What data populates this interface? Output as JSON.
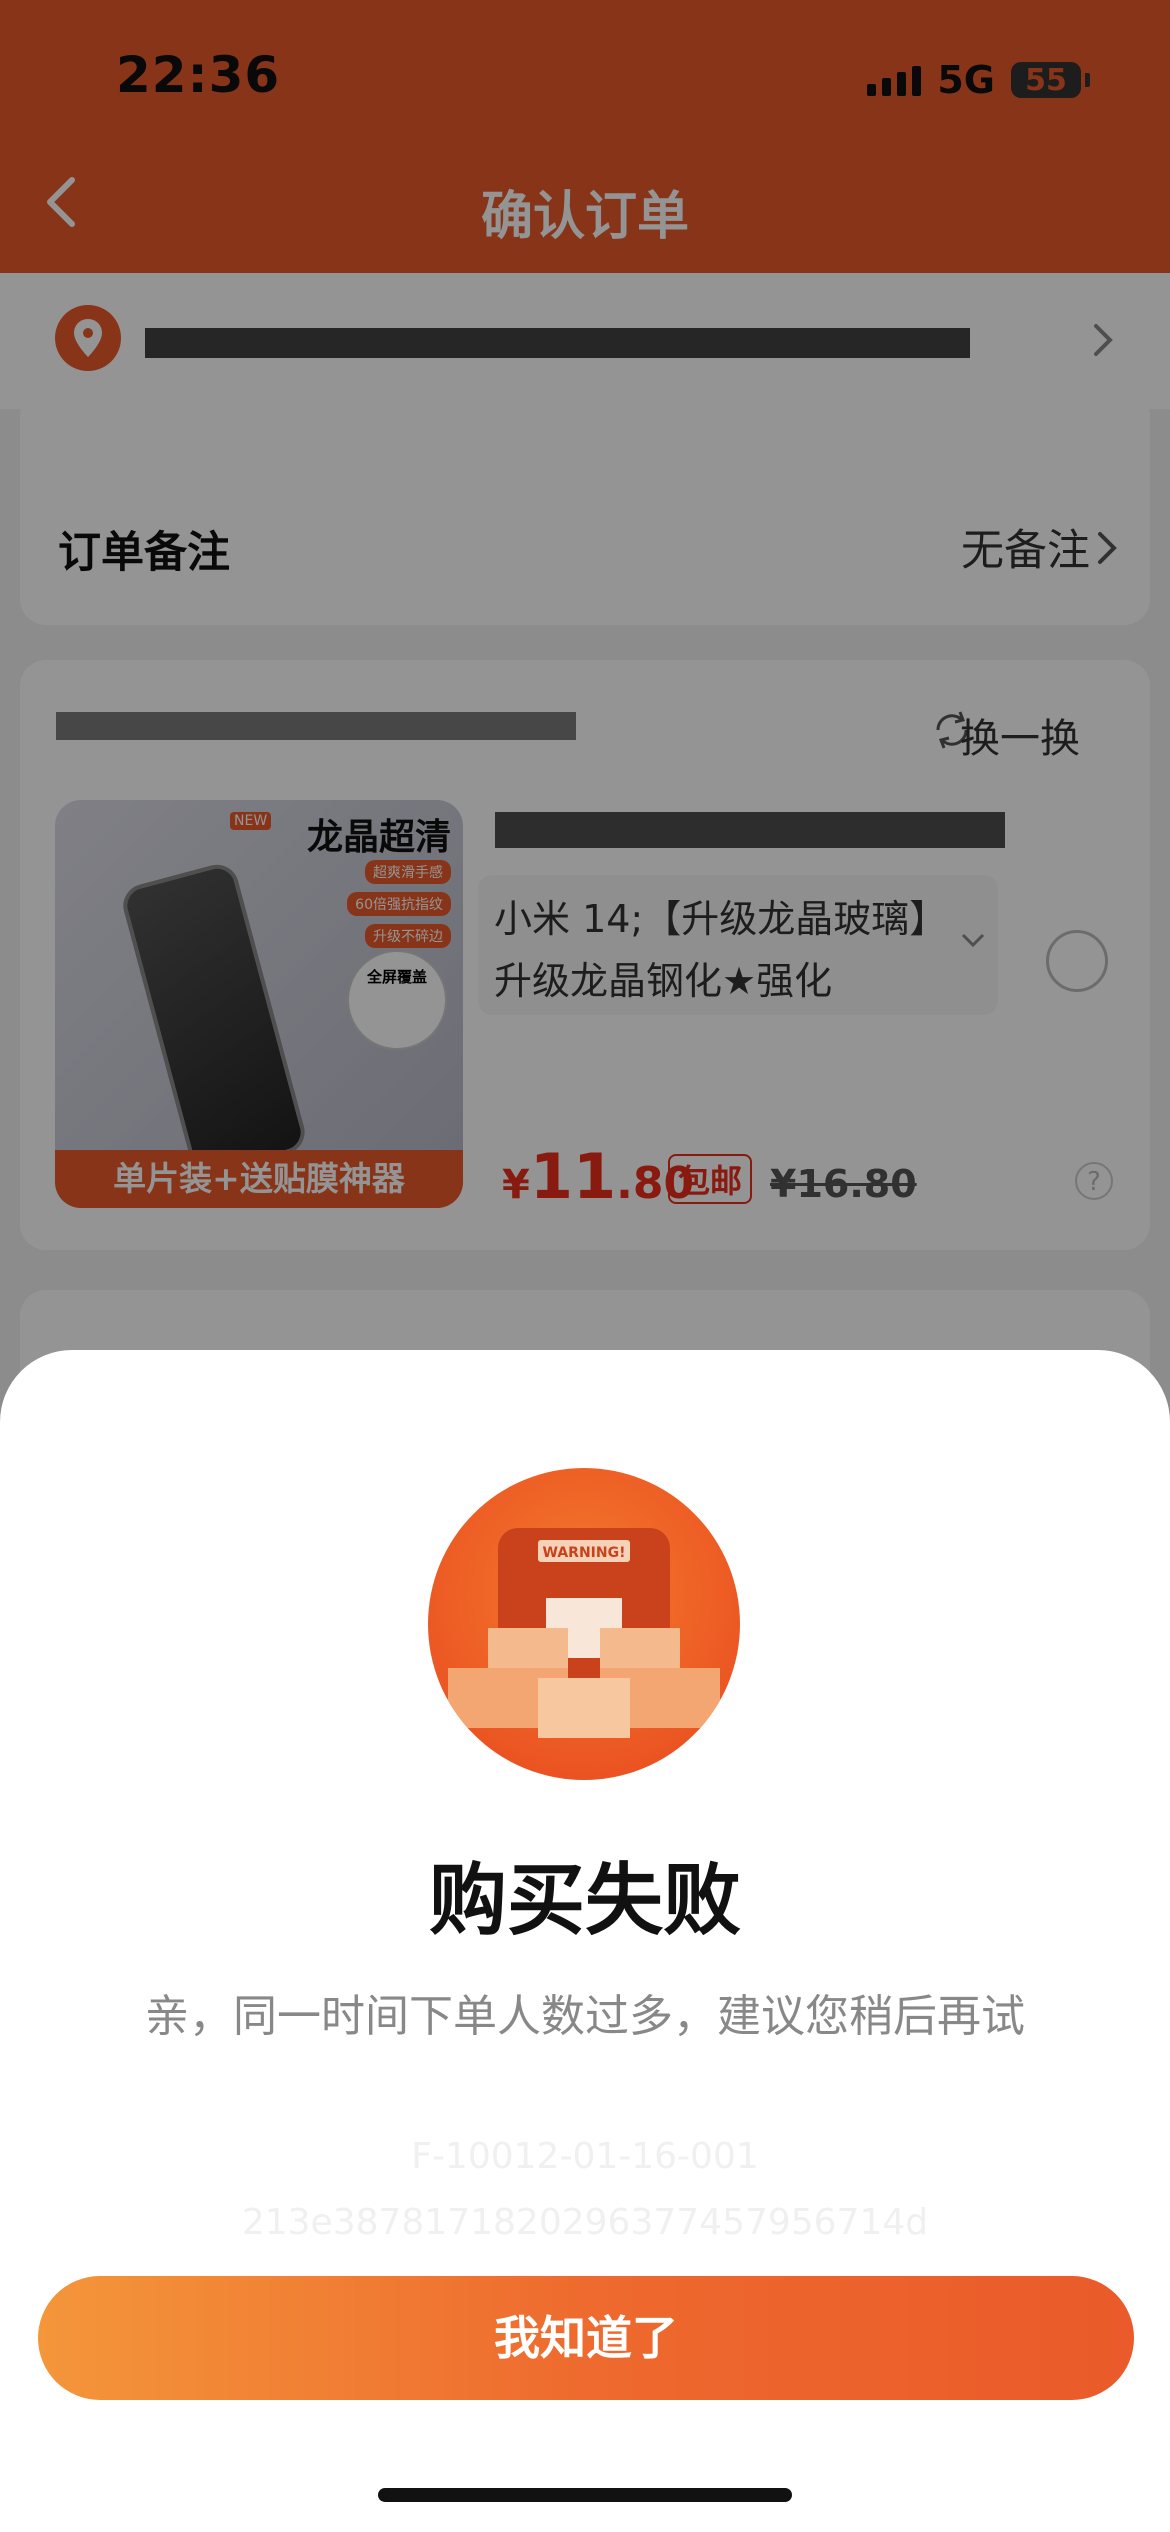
{
  "status_bar": {
    "time": "22:36",
    "network": "5G",
    "battery": "55"
  },
  "header": {
    "title": "确认订单"
  },
  "order_note": {
    "label": "订单备注",
    "value": "无备注"
  },
  "product": {
    "swap_label": "换一换",
    "image": {
      "badge_new": "NEW",
      "title": "龙晶超清",
      "features": [
        "超爽滑手感",
        "60倍强抗指纹",
        "升级不碎边"
      ],
      "bubble": "全屏覆盖",
      "banner": "单片装+送贴膜神器"
    },
    "sku": "小米 14;【升级龙晶玻璃】升级龙晶钢化★强化",
    "price_symbol": "¥",
    "price_int": "11",
    "price_dec": ".80",
    "shipping_badge": "包邮",
    "original_price": "¥16.80",
    "help": "?"
  },
  "dialog": {
    "title": "购买失败",
    "message": "亲，同一时间下单人数过多，建议您稍后再试",
    "error_code_line1": "F-10012-01-16-001",
    "error_code_line2": "213e3878171820296377457956714d",
    "warning_sign": "WARNING!",
    "button_label": "我知道了"
  },
  "colors": {
    "brand": "#ea5a2a",
    "price": "#ea2d1a"
  }
}
